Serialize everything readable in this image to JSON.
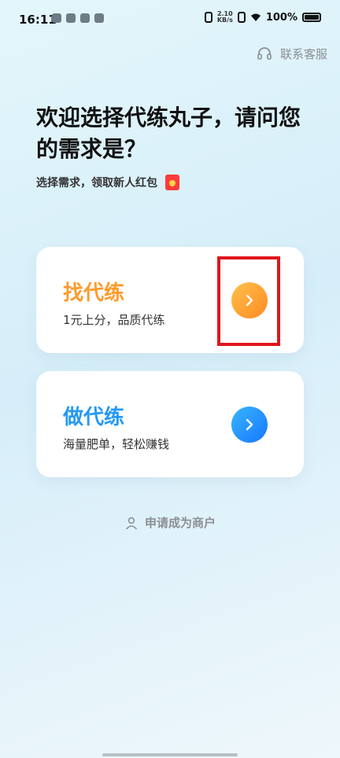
{
  "status": {
    "time": "16:11",
    "speed_top": "2.10",
    "speed_bottom": "KB/s",
    "battery": "100%"
  },
  "header": {
    "service_label": "联系客服"
  },
  "welcome": {
    "title": "欢迎选择代练丸子，请问您的需求是？",
    "subtitle": "选择需求，领取新人红包"
  },
  "cards": [
    {
      "title": "找代练",
      "desc": "1元上分，品质代练",
      "accent": "#ff9a2a"
    },
    {
      "title": "做代练",
      "desc": "海量肥单，轻松赚钱",
      "accent": "#2499f5"
    }
  ],
  "merchant": {
    "label": "申请成为商户"
  },
  "icons": [
    "headset-icon",
    "chevron-right-icon",
    "person-icon",
    "red-packet-icon",
    "wifi-icon",
    "battery-icon"
  ]
}
